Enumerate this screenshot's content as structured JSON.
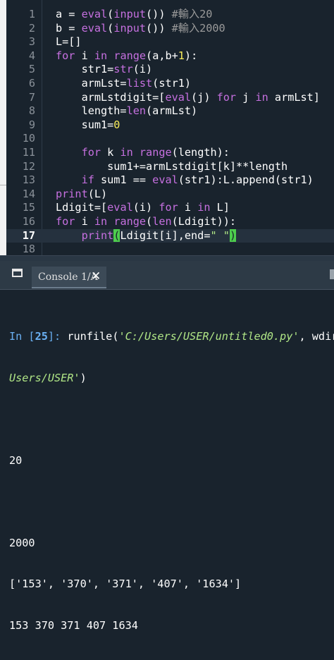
{
  "editor": {
    "active_line": 17,
    "lines": [
      {
        "n": "1",
        "t": [
          [
            "op",
            "a = "
          ],
          [
            "bi",
            "eval"
          ],
          [
            "op",
            "("
          ],
          [
            "bi",
            "input"
          ],
          [
            "op",
            "()) "
          ],
          [
            "cm",
            "#輸入20"
          ]
        ]
      },
      {
        "n": "2",
        "t": [
          [
            "op",
            "b = "
          ],
          [
            "bi",
            "eval"
          ],
          [
            "op",
            "("
          ],
          [
            "bi",
            "input"
          ],
          [
            "op",
            "()) "
          ],
          [
            "cm",
            "#輸入2000"
          ]
        ]
      },
      {
        "n": "3",
        "t": [
          [
            "op",
            "L=[]"
          ]
        ]
      },
      {
        "n": "4",
        "t": [
          [
            "kw",
            "for"
          ],
          [
            "op",
            " i "
          ],
          [
            "kw",
            "in"
          ],
          [
            "op",
            " "
          ],
          [
            "bi",
            "range"
          ],
          [
            "op",
            "(a,b+"
          ],
          [
            "num",
            "1"
          ],
          [
            "op",
            "):"
          ]
        ]
      },
      {
        "n": "5",
        "t": [
          [
            "op",
            "    str1="
          ],
          [
            "bi",
            "str"
          ],
          [
            "op",
            "(i)"
          ]
        ]
      },
      {
        "n": "6",
        "t": [
          [
            "op",
            "    armLst="
          ],
          [
            "bi",
            "list"
          ],
          [
            "op",
            "(str1)"
          ]
        ]
      },
      {
        "n": "7",
        "t": [
          [
            "op",
            "    armLstdigit=["
          ],
          [
            "bi",
            "eval"
          ],
          [
            "op",
            "(j) "
          ],
          [
            "kw",
            "for"
          ],
          [
            "op",
            " j "
          ],
          [
            "kw",
            "in"
          ],
          [
            "op",
            " armLst]"
          ]
        ]
      },
      {
        "n": "8",
        "t": [
          [
            "op",
            "    length="
          ],
          [
            "bi",
            "len"
          ],
          [
            "op",
            "(armLst)"
          ]
        ]
      },
      {
        "n": "9",
        "t": [
          [
            "op",
            "    sum1="
          ],
          [
            "num",
            "0"
          ]
        ]
      },
      {
        "n": "10",
        "t": []
      },
      {
        "n": "11",
        "t": [
          [
            "op",
            "    "
          ],
          [
            "kw",
            "for"
          ],
          [
            "op",
            " k "
          ],
          [
            "kw",
            "in"
          ],
          [
            "op",
            " "
          ],
          [
            "bi",
            "range"
          ],
          [
            "op",
            "(length):"
          ]
        ]
      },
      {
        "n": "12",
        "t": [
          [
            "op",
            "        sum1+=armLstdigit[k]**length"
          ]
        ]
      },
      {
        "n": "13",
        "t": [
          [
            "op",
            "    "
          ],
          [
            "kw",
            "if"
          ],
          [
            "op",
            " sum1 == "
          ],
          [
            "bi",
            "eval"
          ],
          [
            "op",
            "(str1):L.append(str1)"
          ]
        ]
      },
      {
        "n": "14",
        "t": [
          [
            "bi",
            "print"
          ],
          [
            "op",
            "(L)"
          ]
        ]
      },
      {
        "n": "15",
        "t": [
          [
            "op",
            "Ldigit=["
          ],
          [
            "bi",
            "eval"
          ],
          [
            "op",
            "(i) "
          ],
          [
            "kw",
            "for"
          ],
          [
            "op",
            " i "
          ],
          [
            "kw",
            "in"
          ],
          [
            "op",
            " L]"
          ]
        ]
      },
      {
        "n": "16",
        "t": [
          [
            "kw",
            "for"
          ],
          [
            "op",
            " i "
          ],
          [
            "kw",
            "in"
          ],
          [
            "op",
            " "
          ],
          [
            "bi",
            "range"
          ],
          [
            "op",
            "("
          ],
          [
            "bi",
            "len"
          ],
          [
            "op",
            "(Ldigit)):"
          ]
        ]
      },
      {
        "n": "17",
        "t": [
          [
            "op",
            "    "
          ],
          [
            "bi",
            "print"
          ],
          [
            "bm",
            "("
          ],
          [
            "op",
            "Ldigit[i],end="
          ],
          [
            "str",
            "\" \""
          ],
          [
            "bm",
            ")"
          ]
        ]
      },
      {
        "n": "18",
        "t": []
      }
    ]
  },
  "console": {
    "tab_label": "Console 1/A",
    "close_glyph": "✕",
    "window_icon": "window-icon",
    "options_icon": "options-icon",
    "prompt_in": "In [",
    "prompt_num": "25",
    "prompt_close": "]: ",
    "run_cmd": "runfile(",
    "run_path1": "'C:/Users/USER/untitled0.py'",
    "run_sep": ", wdir",
    "run_path2": "Users/USER'",
    "run_end": ")",
    "input_a": "20",
    "input_b": "2000",
    "list_output": "['153', '370', '371', '407', '1634']",
    "digits_output": "153 370 371 407 1634"
  },
  "colors": {
    "background": "#19232d",
    "keyword": "#c670e0",
    "number": "#faed5c",
    "comment": "#9a9a9a",
    "string": "#b0e686",
    "bracket_match": "#4dcc4d",
    "prompt": "#6ab0f3"
  }
}
